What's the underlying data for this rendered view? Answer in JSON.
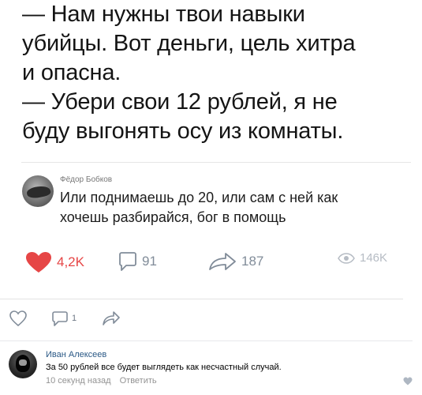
{
  "post": {
    "lines": [
      "— Нам нужны твои навыки",
      "убийцы. Вот деньги, цель хитра",
      "и опасна.",
      "— Убери свои 12 рублей, я не",
      "буду выгонять осу из комнаты."
    ]
  },
  "embedded_comment": {
    "author": "Фёдор Бобков",
    "text_line1": "Или поднимаешь до 20, или сам с ней как",
    "text_line2": "хочешь разбирайся, бог в помощь"
  },
  "stats": {
    "likes": "4,2K",
    "comments": "91",
    "reposts": "187",
    "views": "146K"
  },
  "actions": {
    "comments_count": "1"
  },
  "comment": {
    "author": "Иван Алексеев",
    "text": "За 50 рублей все будет выглядеть как несчастный случай.",
    "time": "10 секунд назад",
    "reply_label": "Ответить"
  },
  "colors": {
    "like_red": "#e64646",
    "link_blue": "#2a5885",
    "icon_gray": "#818c99"
  }
}
